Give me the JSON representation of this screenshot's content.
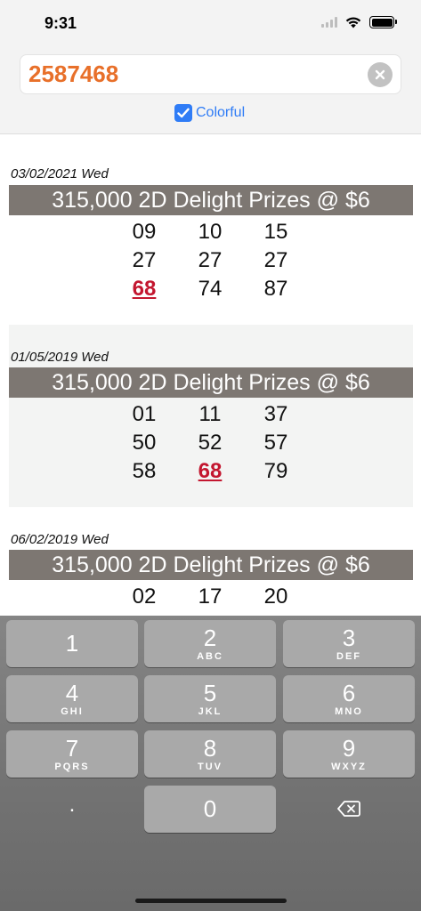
{
  "status": {
    "time": "9:31"
  },
  "search": {
    "value": "2587468"
  },
  "option": {
    "label": "Colorful",
    "checked": true
  },
  "prize_label": "315,000 2D Delight Prizes @ $6",
  "results": [
    {
      "date": "03/02/2021 Wed",
      "prize": "315,000 2D Delight Prizes @ $6",
      "numbers": [
        [
          "09",
          "10",
          "15"
        ],
        [
          "27",
          "27",
          "27"
        ],
        [
          "68",
          "74",
          "87"
        ]
      ],
      "hit": [
        [
          2,
          0
        ]
      ]
    },
    {
      "date": "01/05/2019 Wed",
      "prize": "315,000 2D Delight Prizes @ $6",
      "numbers": [
        [
          "01",
          "11",
          "37"
        ],
        [
          "50",
          "52",
          "57"
        ],
        [
          "58",
          "68",
          "79"
        ]
      ],
      "hit": [
        [
          2,
          1
        ]
      ]
    },
    {
      "date": "06/02/2019 Wed",
      "prize": "315,000 2D Delight Prizes @ $6",
      "numbers": [
        [
          "02",
          "17",
          "20"
        ]
      ],
      "hit": []
    }
  ],
  "keypad": {
    "keys": [
      {
        "digit": "1",
        "letters": ""
      },
      {
        "digit": "2",
        "letters": "ABC"
      },
      {
        "digit": "3",
        "letters": "DEF"
      },
      {
        "digit": "4",
        "letters": "GHI"
      },
      {
        "digit": "5",
        "letters": "JKL"
      },
      {
        "digit": "6",
        "letters": "MNO"
      },
      {
        "digit": "7",
        "letters": "PQRS"
      },
      {
        "digit": "8",
        "letters": "TUV"
      },
      {
        "digit": "9",
        "letters": "WXYZ"
      },
      {
        "digit": ".",
        "letters": ""
      },
      {
        "digit": "0",
        "letters": ""
      }
    ],
    "backspace_icon": "backspace-icon"
  },
  "colors": {
    "accent": "#2f7cf6",
    "search_text": "#e8702a",
    "hit": "#c3162f",
    "prize_bar": "#7d7772"
  }
}
